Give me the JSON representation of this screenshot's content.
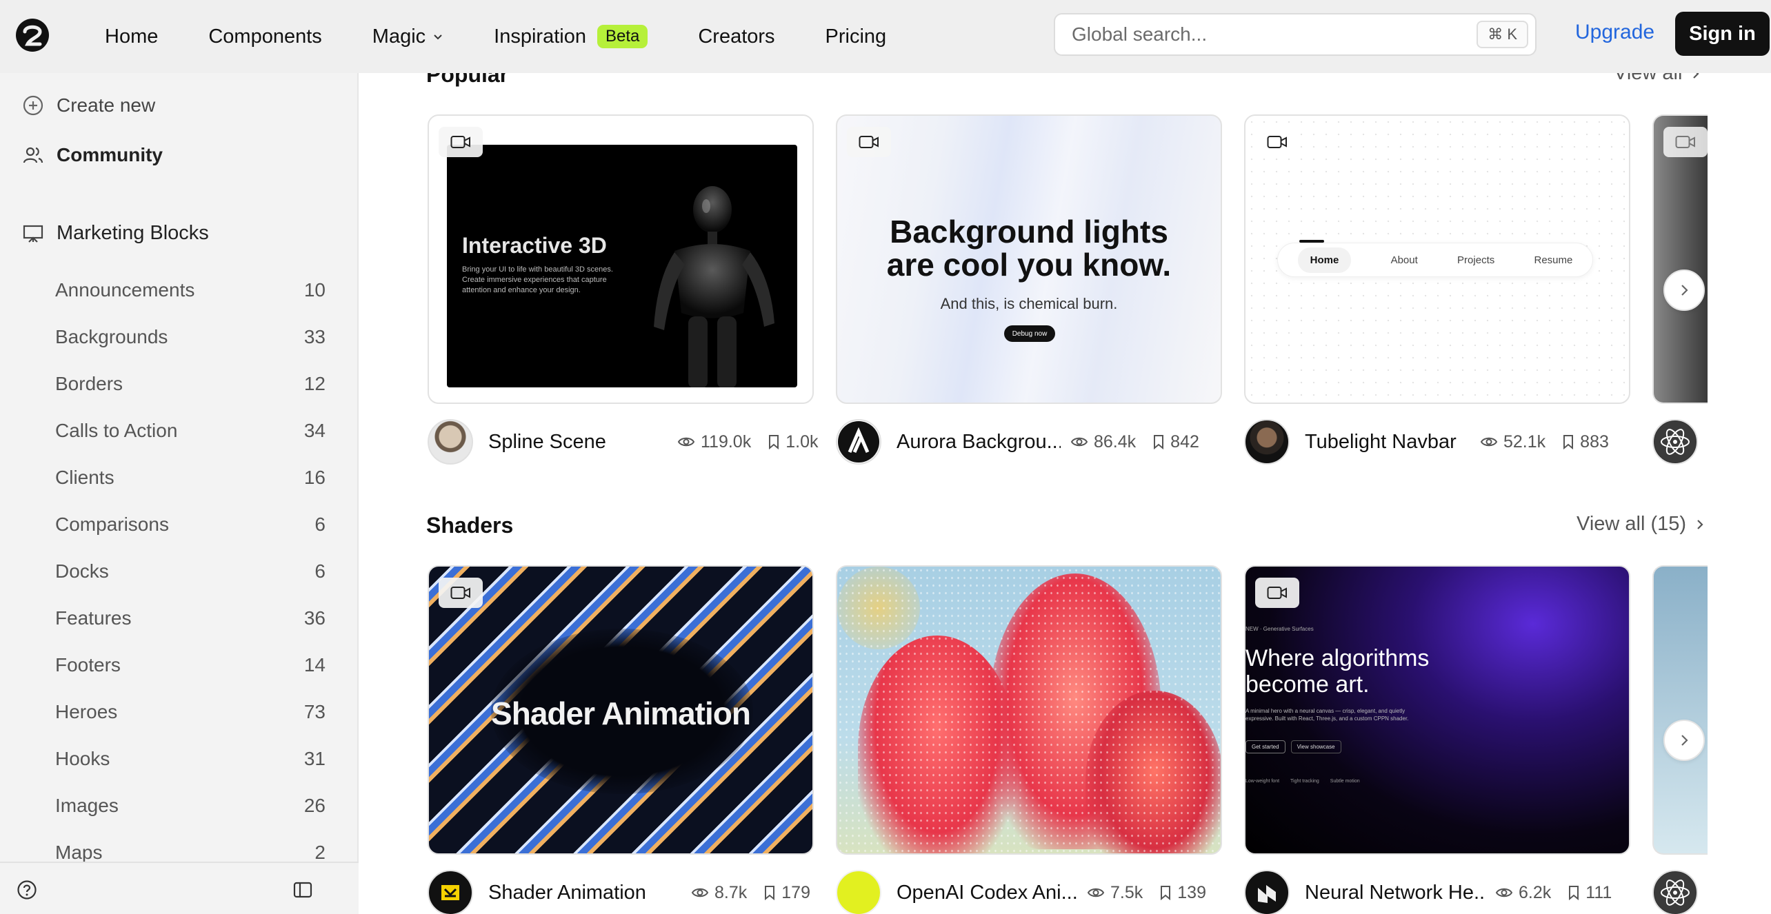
{
  "topbar": {
    "nav": [
      "Home",
      "Components",
      "Magic",
      "Inspiration",
      "Creators",
      "Pricing"
    ],
    "beta_label": "Beta",
    "search_placeholder": "Global search...",
    "search_shortcut": "⌘ K",
    "upgrade_label": "Upgrade",
    "signin_label": "Sign in"
  },
  "sidebar": {
    "create_new": "Create new",
    "community": "Community",
    "section": "Marketing Blocks",
    "categories": [
      {
        "label": "Announcements",
        "count": "10"
      },
      {
        "label": "Backgrounds",
        "count": "33"
      },
      {
        "label": "Borders",
        "count": "12"
      },
      {
        "label": "Calls to Action",
        "count": "34"
      },
      {
        "label": "Clients",
        "count": "16"
      },
      {
        "label": "Comparisons",
        "count": "6"
      },
      {
        "label": "Docks",
        "count": "6"
      },
      {
        "label": "Features",
        "count": "36"
      },
      {
        "label": "Footers",
        "count": "14"
      },
      {
        "label": "Heroes",
        "count": "73"
      },
      {
        "label": "Hooks",
        "count": "31"
      },
      {
        "label": "Images",
        "count": "26"
      },
      {
        "label": "Maps",
        "count": "2"
      }
    ]
  },
  "popular": {
    "title": "Popular",
    "view_all": "View all",
    "cards": [
      {
        "title": "Spline Scene",
        "views": "119.0k",
        "saves": "1.0k",
        "preview": {
          "heading": "Interactive 3D",
          "body": "Bring your UI to life with beautiful 3D scenes. Create immersive experiences that capture attention and enhance your design."
        }
      },
      {
        "title": "Aurora Backgrou...",
        "views": "86.4k",
        "saves": "842",
        "preview": {
          "heading": "Background lights are cool you know.",
          "sub": "And this, is chemical burn.",
          "button": "Debug now"
        }
      },
      {
        "title": "Tubelight Navbar",
        "views": "52.1k",
        "saves": "883",
        "preview": {
          "items": [
            "Home",
            "About",
            "Projects",
            "Resume"
          ]
        }
      }
    ]
  },
  "shaders": {
    "title": "Shaders",
    "view_all": "View all (15)",
    "cards": [
      {
        "title": "Shader Animation",
        "views": "8.7k",
        "saves": "179",
        "preview": {
          "heading": "Shader Animation"
        }
      },
      {
        "title": "OpenAI Codex Ani...",
        "views": "7.5k",
        "saves": "139"
      },
      {
        "title": "Neural Network He...",
        "views": "6.2k",
        "saves": "111",
        "preview": {
          "kicker": "NEW · Generative Surfaces",
          "heading": "Where algorithms become art.",
          "body": "A minimal hero with a neural canvas — crisp, elegant, and quietly expressive. Built with React, Three.js, and a custom CPPN shader.",
          "btn1": "Get started",
          "btn2": "View showcase",
          "f1": "Low-weight font",
          "f2": "Tight tracking",
          "f3": "Subtle motion"
        }
      }
    ]
  },
  "colors": {
    "accent": "#2266dd",
    "beta": "#b6f03a",
    "dark": "#111111"
  }
}
